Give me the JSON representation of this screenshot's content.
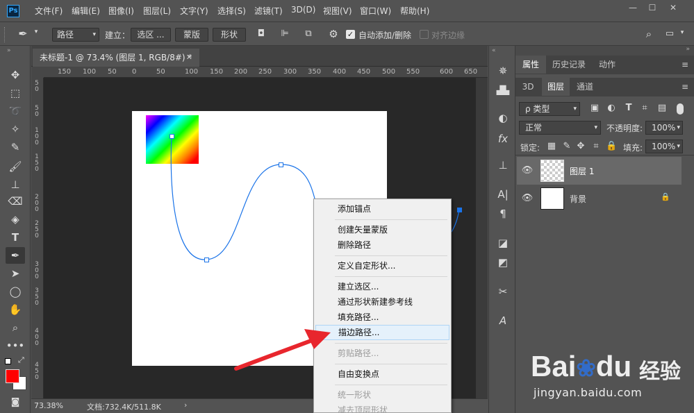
{
  "app": {
    "logo": "Ps"
  },
  "menubar": [
    "文件(F)",
    "编辑(E)",
    "图像(I)",
    "图层(L)",
    "文字(Y)",
    "选择(S)",
    "滤镜(T)",
    "3D(D)",
    "视图(V)",
    "窗口(W)",
    "帮助(H)"
  ],
  "window_controls": {
    "minimize": "—",
    "maximize": "☐",
    "close": "✕"
  },
  "options": {
    "mode_select": "路径",
    "make_label": "建立：",
    "selection_btn": "选区 ...",
    "mask_btn": "蒙版",
    "shape_btn": "形状",
    "auto_add_delete": "自动添加/删除",
    "align_edges": "对齐边缘"
  },
  "document": {
    "tab_title": "未标题-1 @ 73.4% (图层 1, RGB/8#) *",
    "zoom": "73.38%",
    "doc_info": "文档:732.4K/511.8K",
    "ruler_h": [
      "150",
      "100",
      "50",
      "0",
      "50",
      "100",
      "150",
      "200",
      "250",
      "300",
      "350",
      "400",
      "450",
      "500",
      "550",
      "600",
      "650"
    ],
    "ruler_v": [
      "5",
      "0",
      "5",
      "0",
      "1",
      "0",
      "0",
      "1",
      "5",
      "0",
      "2",
      "0",
      "0",
      "2",
      "5",
      "0",
      "3",
      "0",
      "0",
      "3",
      "5",
      "0",
      "4",
      "0",
      "0",
      "4",
      "5",
      "0"
    ]
  },
  "context_menu": {
    "items": [
      {
        "label": "添加锚点",
        "disabled": false
      },
      {
        "label": "创建矢量蒙版",
        "disabled": false
      },
      {
        "label": "删除路径",
        "disabled": false
      },
      {
        "label": "定义自定形状...",
        "disabled": false
      },
      {
        "label": "建立选区...",
        "disabled": false
      },
      {
        "label": "通过形状新建参考线",
        "disabled": false
      },
      {
        "label": "填充路径...",
        "disabled": false
      },
      {
        "label": "描边路径...",
        "disabled": false,
        "highlighted": true
      },
      {
        "label": "剪贴路径...",
        "disabled": true
      },
      {
        "label": "自由变换点",
        "disabled": false
      },
      {
        "label": "统一形状",
        "disabled": true
      },
      {
        "label": "减去顶层形状",
        "disabled": true
      }
    ]
  },
  "panels": {
    "top_tabs": [
      "属性",
      "历史记录",
      "动作"
    ],
    "layer_tabs": [
      "3D",
      "图层",
      "通道"
    ],
    "filter_kind": "ρ 类型",
    "blend_mode": "正常",
    "opacity_label": "不透明度:",
    "opacity_value": "100%",
    "lock_label": "锁定:",
    "fill_label": "填充:",
    "fill_value": "100%",
    "layers": [
      {
        "name": "图层 1",
        "selected": true
      },
      {
        "name": "背景",
        "selected": false,
        "locked": true
      }
    ]
  },
  "watermark": {
    "brand": "Bai",
    "brand2": "du",
    "cn": "经验",
    "url": "jingyan.baidu.com"
  },
  "colors": {
    "accent_path": "#1a73e8",
    "arrow": "#e8262d",
    "foreground": "#ff0000",
    "background": "#ffffff"
  }
}
